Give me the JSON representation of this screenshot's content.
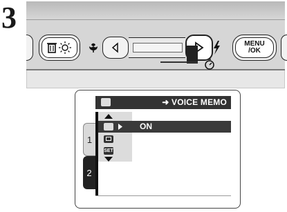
{
  "step_number": "3",
  "buttons": {
    "delete_icon": "trash-sun-icon",
    "macro_icon": "flower-icon",
    "left_arrow_icon": "triangle-left-icon",
    "right_arrow_icon": "triangle-right-icon",
    "flash_icon": "lightning-icon",
    "self_timer_icon": "timer-icon",
    "menu_ok_line1": "MENU",
    "menu_ok_line2": "/OK"
  },
  "menu": {
    "header_icon": "voice-memo-icon",
    "header_title": "➜ VOICE MEMO",
    "selected_value": "ON",
    "tab1_label": "1",
    "tab2_label": "2",
    "items": [
      {
        "icon": "voice-memo-icon"
      },
      {
        "icon": "frame-icon"
      },
      {
        "icon": "SET"
      }
    ]
  },
  "colors": {
    "menu_dark": "#333333",
    "highlight": "#3a3a3a",
    "panel_gray": "#d6d6d6"
  }
}
